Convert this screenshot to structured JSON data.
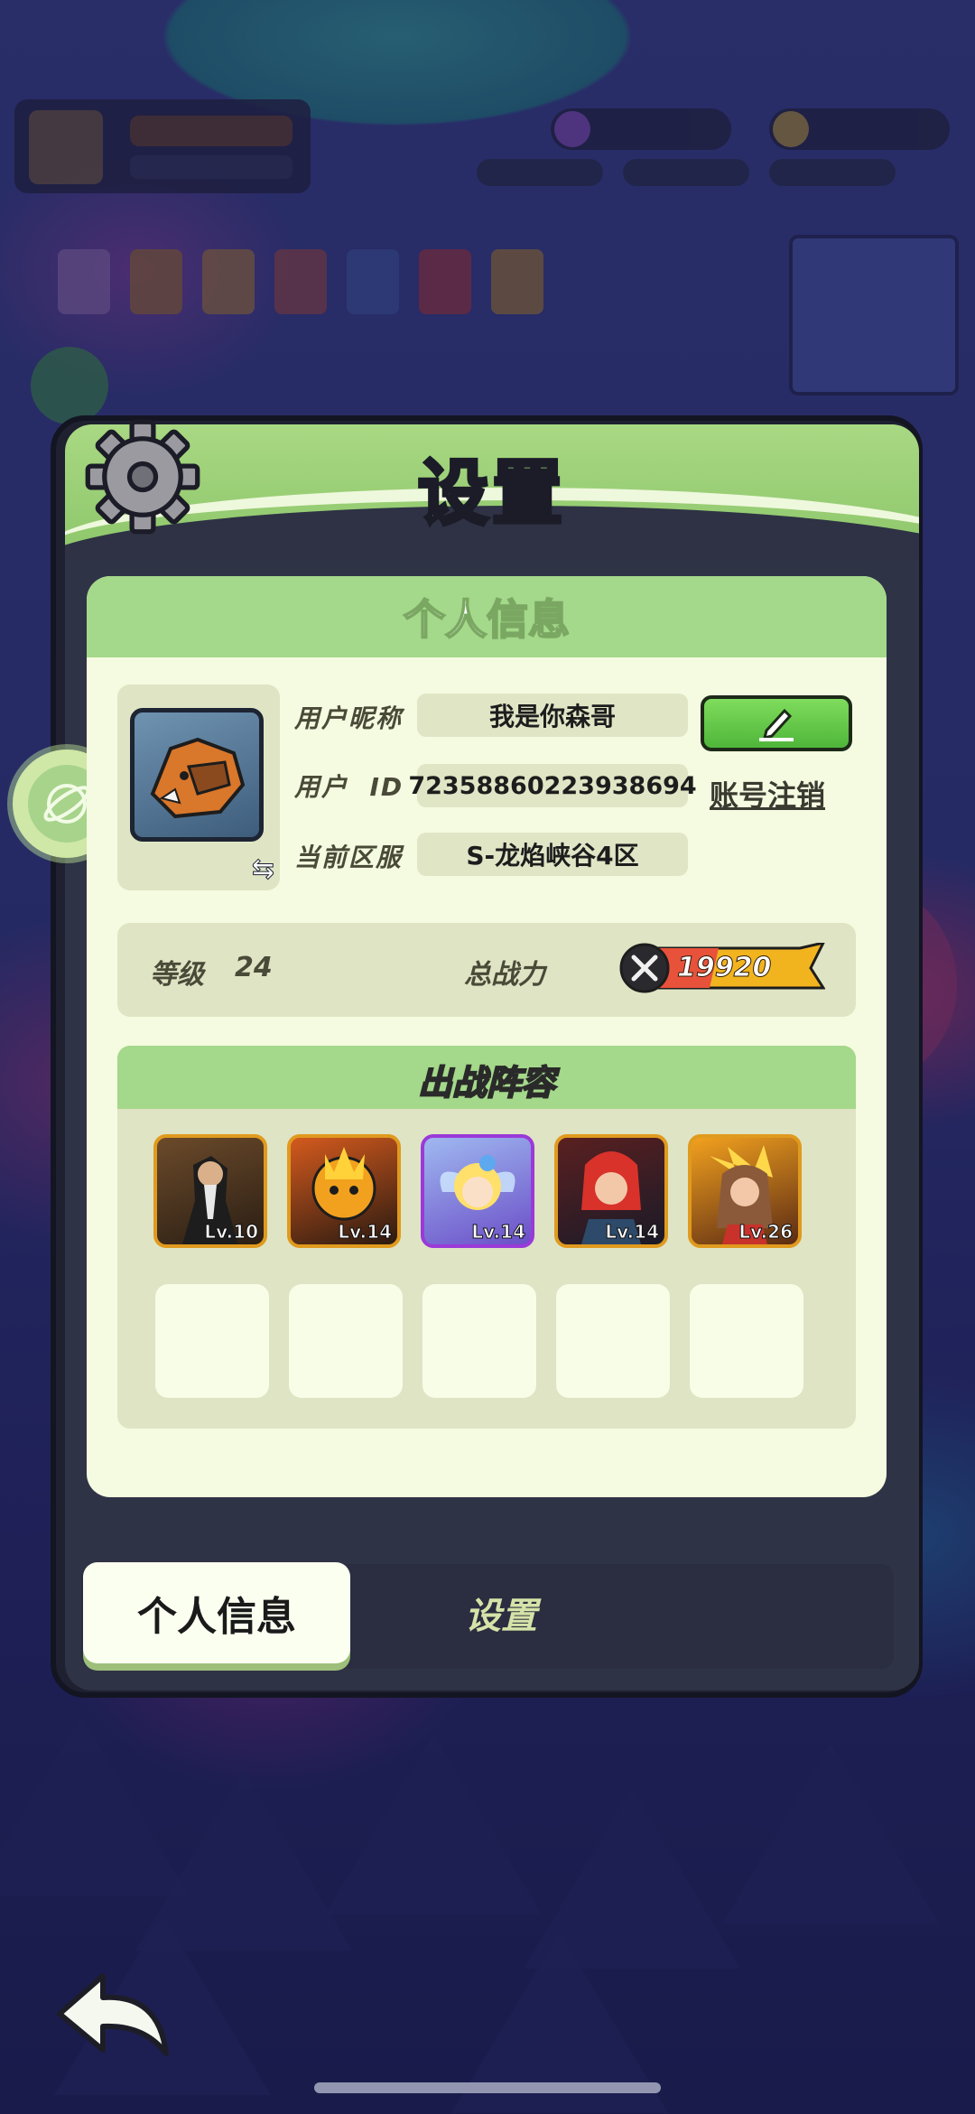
{
  "dialog": {
    "title": "设置"
  },
  "panel": {
    "title": "个人信息",
    "labels": {
      "nickname": "用户昵称",
      "user_id": "用户  ID",
      "server": "当前区服"
    },
    "nickname": "我是你森哥",
    "user_id": "72358860223938694",
    "server": "S-龙焰峡谷4区",
    "cancel_account": "账号注销",
    "level_label": "等级",
    "level_value": "24",
    "power_label": "总战力",
    "power_value": "19920"
  },
  "lineup": {
    "title": "出战阵容",
    "heroes": [
      {
        "level": "Lv.10",
        "frame": "orange"
      },
      {
        "level": "Lv.14",
        "frame": "orange"
      },
      {
        "level": "Lv.14",
        "frame": "purple"
      },
      {
        "level": "Lv.14",
        "frame": "orange"
      },
      {
        "level": "Lv.26",
        "frame": "orange"
      }
    ],
    "empty_slots": 5
  },
  "tabs": [
    {
      "label": "个人信息",
      "active": true
    },
    {
      "label": "设置",
      "active": false
    }
  ],
  "icons": {
    "gear": "gear-icon",
    "edit": "pencil-icon",
    "swap": "swap-icon",
    "planet": "planet-icon",
    "back": "back-arrow-icon",
    "power": "crossed-swords-icon"
  },
  "colors": {
    "header_green": "#a4d88a",
    "panel_bg": "#f4fbe0",
    "edit_green": "#4fb63a",
    "dialog_dark": "#2f3346"
  }
}
